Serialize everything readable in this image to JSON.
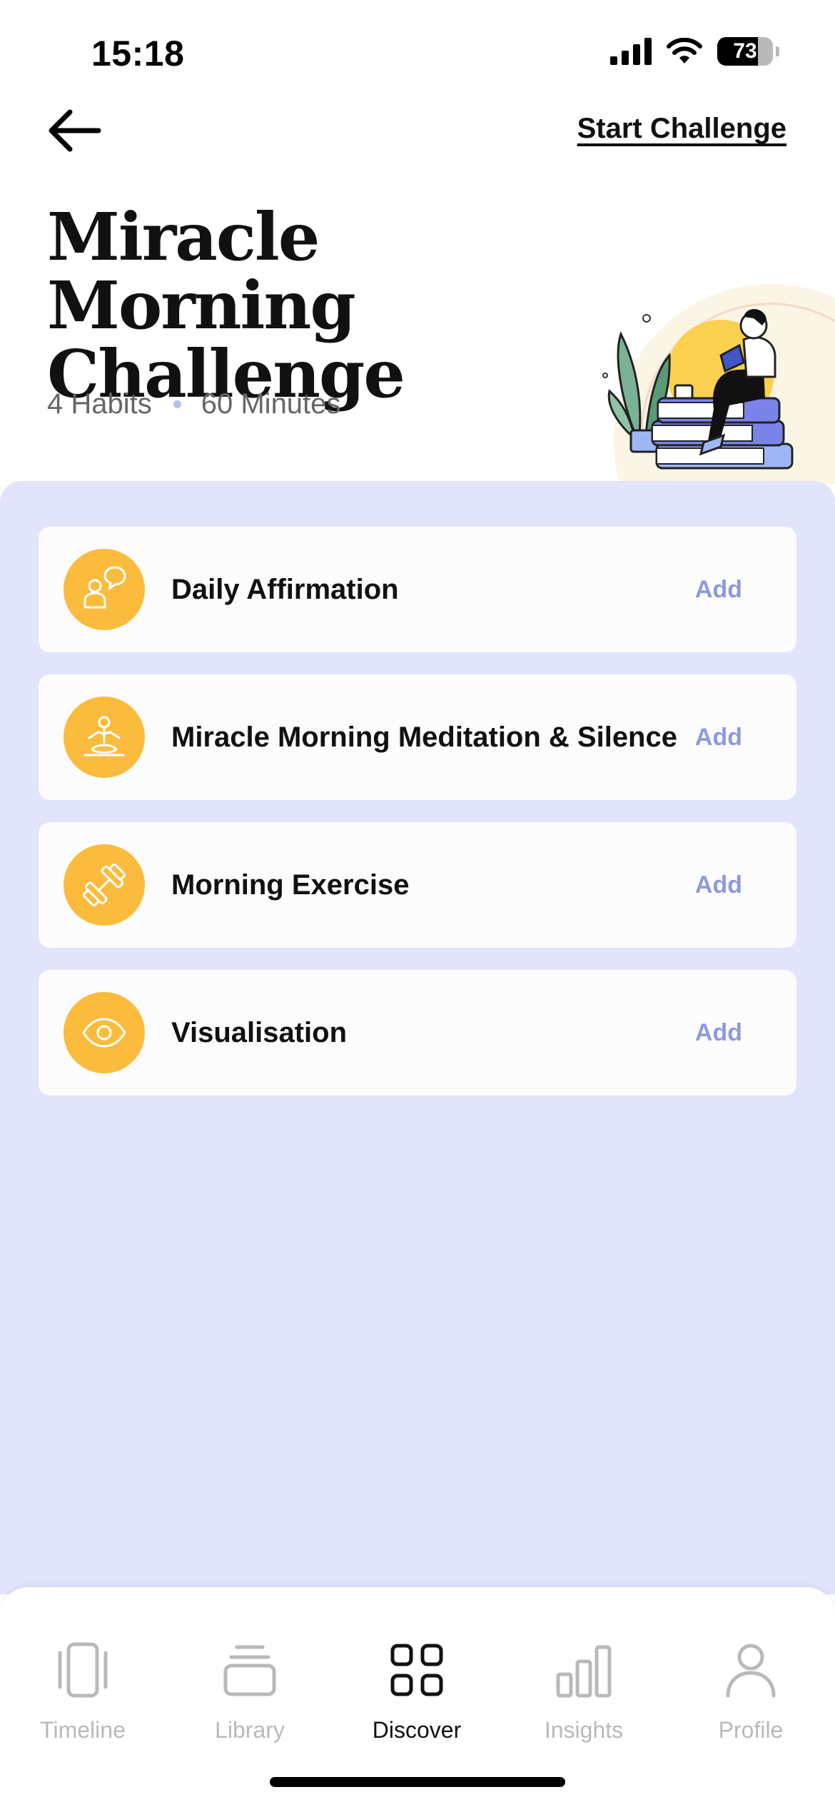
{
  "status_bar": {
    "time": "15:18",
    "battery_level": "73",
    "battery_percent": 73
  },
  "header": {
    "start_link": "Start Challenge",
    "title": "Miracle Morning Challenge",
    "habits_count": "4 Habits",
    "duration": "60 Minutes"
  },
  "habits": [
    {
      "name": "Daily Affirmation",
      "icon": "affirmation-icon",
      "action": "Add"
    },
    {
      "name": "Miracle Morning Meditation & Silence",
      "icon": "meditation-icon",
      "action": "Add"
    },
    {
      "name": "Morning Exercise",
      "icon": "dumbbell-icon",
      "action": "Add"
    },
    {
      "name": "Visualisation",
      "icon": "eye-icon",
      "action": "Add"
    }
  ],
  "tabs": [
    {
      "label": "Timeline",
      "icon": "timeline-icon",
      "active": false
    },
    {
      "label": "Library",
      "icon": "library-icon",
      "active": false
    },
    {
      "label": "Discover",
      "icon": "discover-grid-icon",
      "active": true
    },
    {
      "label": "Insights",
      "icon": "bar-chart-icon",
      "active": false
    },
    {
      "label": "Profile",
      "icon": "person-icon",
      "active": false
    }
  ],
  "colors": {
    "panel_bg": "#e2e4fc",
    "icon_circle": "#fbbc3d",
    "add_text": "#8f99e0",
    "inactive_tab": "#b9b9b9"
  }
}
